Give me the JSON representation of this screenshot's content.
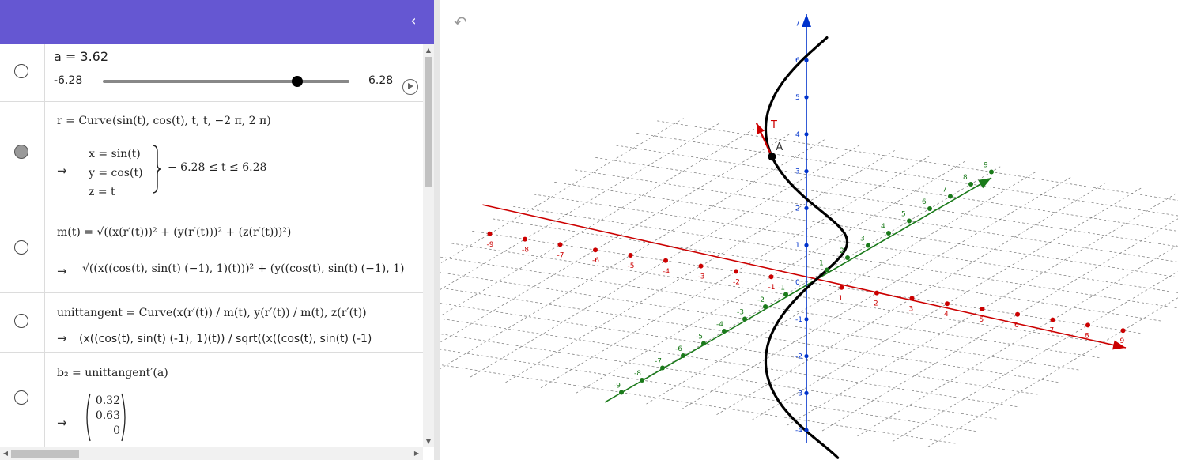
{
  "algebra": {
    "collapse_icon": "‹",
    "slider": {
      "label": "a = 3.62",
      "min_label": "-6.28",
      "max_label": "6.28",
      "min": -6.28,
      "max": 6.28,
      "value": 3.62
    },
    "curve_r": {
      "definition": "r = Curve(sin(t), cos(t), t, t, −2 π, 2 π)",
      "arrow": "→",
      "x": "x = sin(t)",
      "y": "y = cos(t)",
      "z": "z = t",
      "range": "− 6.28 ≤ t ≤ 6.28"
    },
    "m": {
      "definition": "m(t) = √((x(r′(t)))² + (y(r′(t)))² + (z(r′(t)))²)",
      "arrow": "→",
      "output": "√((x((cos(t), sin(t) (−1), 1)(t)))² + (y((cos(t), sin(t) (−1), 1)"
    },
    "unittangent": {
      "definition": "unittangent = Curve(x(r′(t)) / m(t), y(r′(t)) / m(t), z(r′(t))",
      "arrow": "→",
      "output": "(x((cos(t), sin(t) (-1), 1)(t)) / sqrt((x((cos(t), sin(t) (-1)"
    },
    "b2": {
      "definition": "b₂ = unittangent′(a)",
      "arrow": "→",
      "values": [
        "0.32",
        "0.63",
        "0"
      ]
    }
  },
  "graphics": {
    "undo_icon": "undo-icon",
    "point_label": "A",
    "vector_label": "T",
    "axis_colors": {
      "x": "#cc0000",
      "y": "#1a7a1a",
      "z": "#0033cc",
      "curve": "#000000"
    },
    "x_ticks": [
      "-9",
      "-8",
      "-7",
      "-6",
      "-5",
      "-4",
      "-3",
      "-2",
      "-1",
      "1",
      "2",
      "3",
      "4",
      "5",
      "6",
      "7",
      "8",
      "9"
    ],
    "y_ticks": [
      "-9",
      "-8",
      "-7",
      "-6",
      "-5",
      "-4",
      "-3",
      "-2",
      "-1",
      "1",
      "2",
      "3",
      "4",
      "5",
      "6",
      "7",
      "8",
      "9"
    ],
    "z_ticks": [
      "-4",
      "-3",
      "-2",
      "-1",
      "0",
      "1",
      "2",
      "3",
      "4",
      "5",
      "6",
      "7"
    ]
  }
}
